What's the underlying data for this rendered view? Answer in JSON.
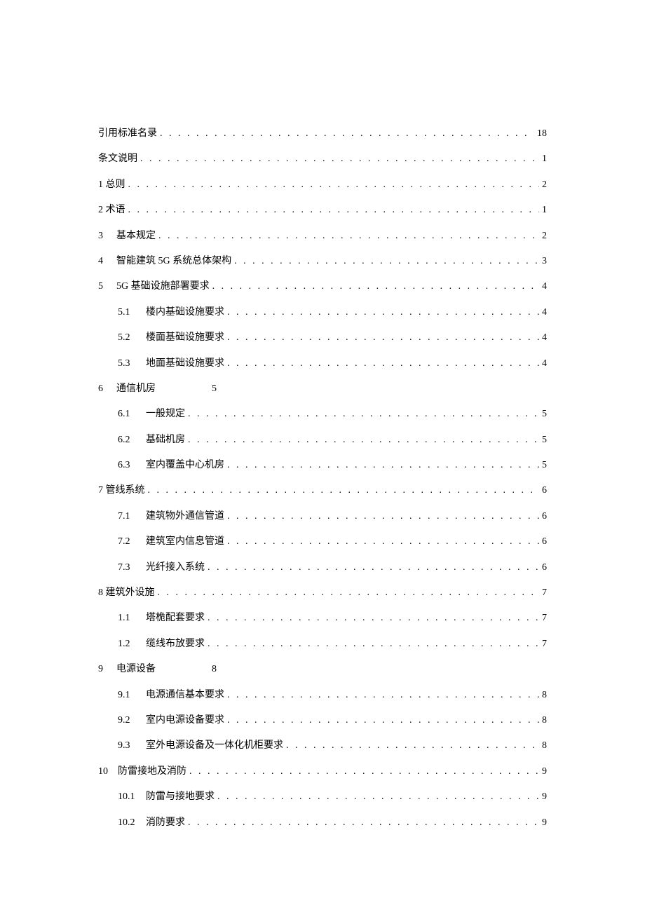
{
  "toc": [
    {
      "level": 1,
      "num": "",
      "title": "引用标准名录",
      "page": "18",
      "nopad": true
    },
    {
      "level": 1,
      "num": "",
      "title": "条文说明",
      "page": "1",
      "nopad": true
    },
    {
      "level": 1,
      "num": "",
      "title": "1 总则",
      "page": "2",
      "nopad": true
    },
    {
      "level": 1,
      "num": "",
      "title": "2 术语",
      "page": "1",
      "nopad": true
    },
    {
      "level": 1,
      "num": "3",
      "title": "基本规定",
      "page": "2"
    },
    {
      "level": 1,
      "num": "4",
      "title": "智能建筑 5G 系统总体架构",
      "page": "3"
    },
    {
      "level": 1,
      "num": "5",
      "title": "5G 基础设施部署要求",
      "page": "4"
    },
    {
      "level": 2,
      "num": "5.1",
      "title": "楼内基础设施要求",
      "page": "4"
    },
    {
      "level": 2,
      "num": "5.2",
      "title": "楼面基础设施要求",
      "page": "4"
    },
    {
      "level": 2,
      "num": "5.3",
      "title": "地面基础设施要求",
      "page": "4"
    },
    {
      "level": 1,
      "num": "6",
      "title": "通信机房",
      "page": "5",
      "inlinepage": true
    },
    {
      "level": 2,
      "num": "6.1",
      "title": "一般规定",
      "page": "5"
    },
    {
      "level": 2,
      "num": "6.2",
      "title": "基础机房",
      "page": "5"
    },
    {
      "level": 2,
      "num": "6.3",
      "title": "室内覆盖中心机房",
      "page": "5"
    },
    {
      "level": 1,
      "num": "",
      "title": "7 管线系统",
      "page": "6",
      "nopad": true
    },
    {
      "level": 2,
      "num": "7.1",
      "title": "建筑物外通信管道",
      "page": "6"
    },
    {
      "level": 2,
      "num": "7.2",
      "title": "建筑室内信息管道",
      "page": "6"
    },
    {
      "level": 2,
      "num": "7.3",
      "title": "光纤接入系统",
      "page": "6"
    },
    {
      "level": 1,
      "num": "",
      "title": "8 建筑外设施",
      "page": "7",
      "nopad": true
    },
    {
      "level": 2,
      "num": "1.1",
      "title": "塔桅配套要求",
      "page": "7"
    },
    {
      "level": 2,
      "num": "1.2",
      "title": "缆线布放要求",
      "page": "7"
    },
    {
      "level": 1,
      "num": "9",
      "title": "电源设备",
      "page": "8",
      "inlinepage": true
    },
    {
      "level": 2,
      "num": "9.1",
      "title": "电源通信基本要求",
      "page": "8"
    },
    {
      "level": 2,
      "num": "9.2",
      "title": "室内电源设备要求",
      "page": "8"
    },
    {
      "level": 2,
      "num": "9.3",
      "title": "室外电源设备及一体化机柜要求",
      "page": "8"
    },
    {
      "level": 1,
      "num": "10",
      "title": "防雷接地及消防",
      "page": "9"
    },
    {
      "level": 2,
      "num": "10.1",
      "title": "防雷与接地要求",
      "page": "9"
    },
    {
      "level": 2,
      "num": "10.2",
      "title": "消防要求",
      "page": "9"
    }
  ]
}
